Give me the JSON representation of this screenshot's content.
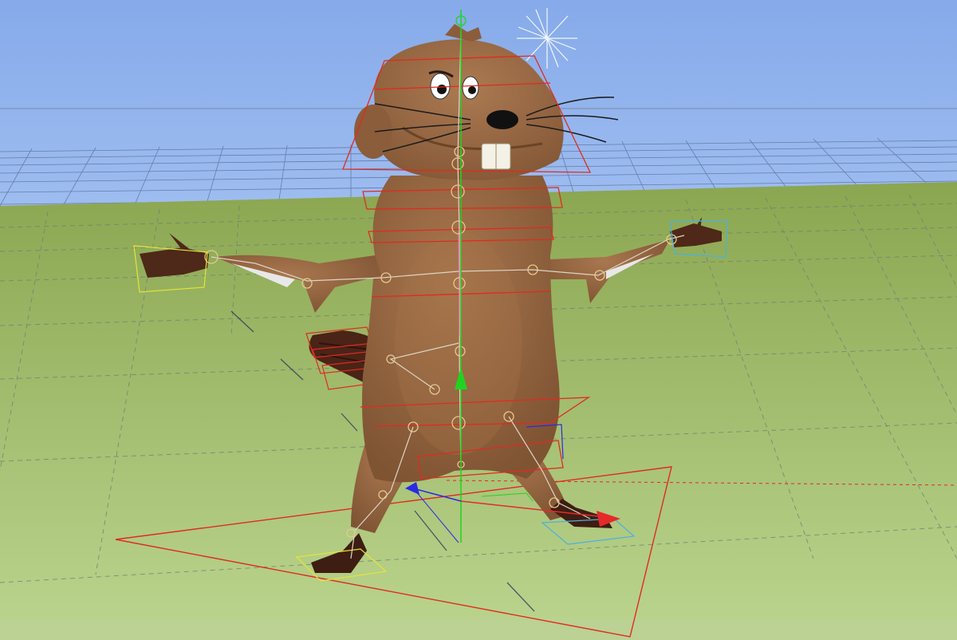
{
  "viewport": {
    "sky_color": "#8fb2ec",
    "ground_color_far": "#93ad58",
    "ground_color_near": "#b7d28a",
    "grid_color": "#6f7f86",
    "horizon_grid_color": "#5a6f9e"
  },
  "character": {
    "body_color": "#9b6a44",
    "body_shadow": "#7e5232",
    "tail_color": "#4a2417",
    "teeth_color": "#f4f1e6",
    "nose_color": "#111111",
    "eye_white": "#ffffff"
  },
  "rig": {
    "control_color": "#e02b1f",
    "bone_color": "#d9d3c8",
    "joint_color": "#e5c98c",
    "spine_highlight": "#e58ab5",
    "hand_control_left": "#e7e23a",
    "hand_control_right": "#4cb0e0",
    "foot_control_left": "#e7e23a",
    "foot_control_right": "#4cb0e0"
  },
  "gizmo": {
    "x_axis_color": "#e52a2a",
    "y_axis_color": "#21d321",
    "z_axis_color": "#2a2ae5"
  },
  "light": {
    "color": "#ffffff",
    "icon": "sun-light-icon"
  }
}
